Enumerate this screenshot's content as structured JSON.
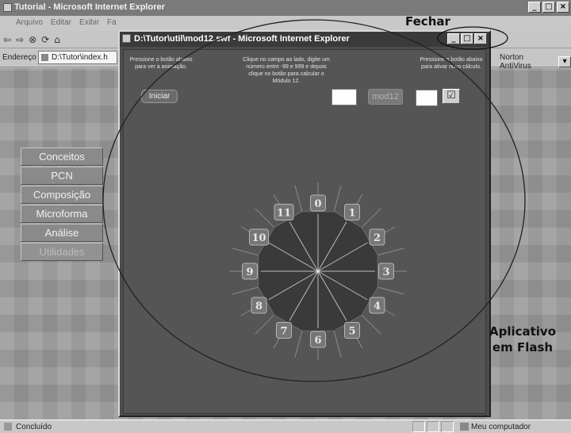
{
  "browser": {
    "title": "Tutorial - Microsoft Internet Explorer",
    "menu": [
      "Arquivo",
      "Editar",
      "Exibir",
      "Fa"
    ],
    "address_label": "Endereço",
    "address_value": "D:\\Tutor\\index.h",
    "norton_label": "Norton AntiVirus",
    "status_text": "Concluído",
    "status_zone": "Meu computador"
  },
  "nav_menu": {
    "items": [
      "Conceitos",
      "PCN",
      "Composição",
      "Microforma",
      "Análise",
      "Utilidades"
    ]
  },
  "popup": {
    "title": "D:\\Tutor\\util\\mod12.swf - Microsoft Internet Explorer",
    "instr_left": "Pressione o botão abaixo para ver a animação.",
    "instr_mid": "Clique no campo ao lado, digite um número entre -99 e 999 e depois clique no botão para calcular o Módulo 12.",
    "instr_right": "Pressione o botão abaixo para ativar novo cálculo.",
    "iniciar_label": "Iniciar",
    "mod12_label": "mod12",
    "check_icon": "checkbox-icon"
  },
  "clock": {
    "numbers": [
      "0",
      "1",
      "2",
      "3",
      "4",
      "5",
      "6",
      "7",
      "8",
      "9",
      "10",
      "11"
    ]
  },
  "annotations": {
    "fechar": "Fechar",
    "aplicativo_line1": "Aplicativo",
    "aplicativo_line2": "em Flash"
  }
}
